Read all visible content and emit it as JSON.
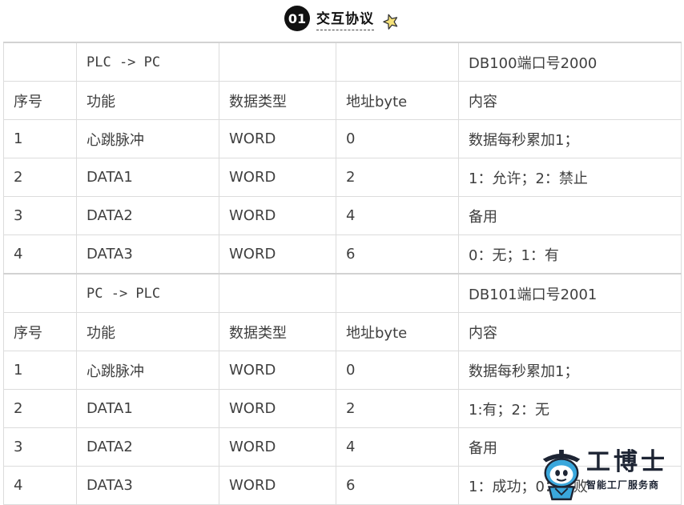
{
  "header": {
    "number": "01",
    "title": "交互协议",
    "star_icon": "star-icon"
  },
  "sections": [
    {
      "direction": "PLC -> PC",
      "db_info": "DB100端口号2000",
      "columns": [
        "序号",
        "功能",
        "数据类型",
        "地址byte",
        "内容"
      ],
      "rows": [
        [
          "1",
          "心跳脉冲",
          "WORD",
          "0",
          "数据每秒累加1；"
        ],
        [
          "2",
          "DATA1",
          "WORD",
          "2",
          "1：允许；2：禁止"
        ],
        [
          "3",
          "DATA2",
          "WORD",
          "4",
          "备用"
        ],
        [
          "4",
          "DATA3",
          "WORD",
          "6",
          "0：无；1：有"
        ]
      ]
    },
    {
      "direction": "PC -> PLC",
      "db_info": "DB101端口号2001",
      "columns": [
        "序号",
        "功能",
        "数据类型",
        "地址byte",
        "内容"
      ],
      "rows": [
        [
          "1",
          "心跳脉冲",
          "WORD",
          "0",
          "数据每秒累加1；"
        ],
        [
          "2",
          "DATA1",
          "WORD",
          "2",
          "1:有；2：无"
        ],
        [
          "3",
          "DATA2",
          "WORD",
          "4",
          "备用"
        ],
        [
          "4",
          "DATA3",
          "WORD",
          "6",
          "1：成功；0：失败"
        ]
      ]
    }
  ],
  "watermark": {
    "brand": "工博士",
    "tagline": "智能工厂服务商",
    "icon": "robot-mascot-icon"
  }
}
